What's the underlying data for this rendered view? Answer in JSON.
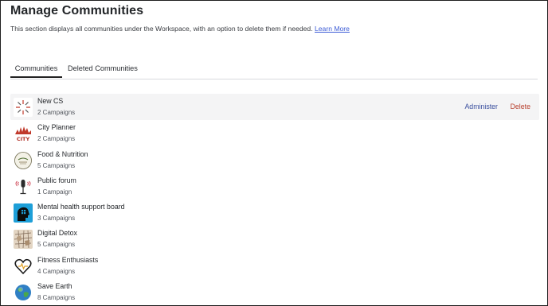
{
  "page": {
    "title": "Manage Communities",
    "description": "This section displays all communities under the Workspace, with an option to delete them if needed.",
    "learn_more": "Learn More"
  },
  "tabs": [
    {
      "label": "Communities",
      "active": true
    },
    {
      "label": "Deleted Communities",
      "active": false
    }
  ],
  "communities": [
    {
      "name": "New CS",
      "count": "2 Campaigns",
      "icon": "new-cs-logo"
    },
    {
      "name": "City Planner",
      "count": "2 Campaigns",
      "icon": "city-planner-logo",
      "logo_text": "CITY"
    },
    {
      "name": "Food & Nutrition",
      "count": "5 Campaigns",
      "icon": "food-nutrition-logo"
    },
    {
      "name": "Public forum",
      "count": "1 Campaign",
      "icon": "microphone-logo"
    },
    {
      "name": "Mental health support board",
      "count": "3 Campaigns",
      "icon": "mental-health-logo"
    },
    {
      "name": "Digital Detox",
      "count": "5 Campaigns",
      "icon": "digital-detox-logo"
    },
    {
      "name": "Fitness Enthusiasts",
      "count": "4 Campaigns",
      "icon": "fitness-heart-logo"
    },
    {
      "name": "Save Earth",
      "count": "8 Campaigns",
      "icon": "earth-globe-logo"
    }
  ],
  "row_actions": {
    "administer": "Administer",
    "delete": "Delete"
  },
  "colors": {
    "link": "#3b5bd6",
    "administer": "#3a4f9e",
    "delete": "#b8402e",
    "highlight_row": "#f4f4f5"
  }
}
